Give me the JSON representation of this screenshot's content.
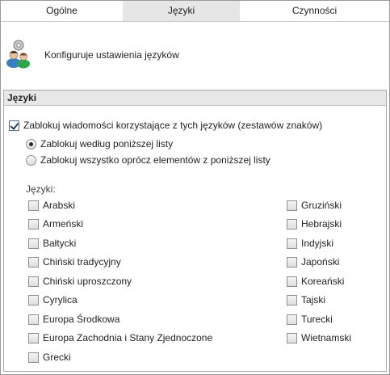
{
  "tabs": [
    {
      "label": "Ogólne"
    },
    {
      "label": "Języki"
    },
    {
      "label": "Czynności"
    }
  ],
  "header": {
    "icon": "users-settings-icon",
    "description": "Konfiguruje ustawienia języków"
  },
  "panel": {
    "title": "Języki",
    "block_checkbox": {
      "label": "Zablokuj wiadomości korzystające z tych języków (zestawów znaków)",
      "checked": true
    },
    "radio_options": [
      {
        "label": "Zablokuj według poniższej listy",
        "selected": true
      },
      {
        "label": "Zablokuj wszystko oprócz elementów z poniższej listy",
        "selected": false
      }
    ],
    "languages_label": "Języki:",
    "languages_left": [
      {
        "label": "Arabski",
        "checked": false
      },
      {
        "label": "Armeński",
        "checked": false
      },
      {
        "label": "Bałtycki",
        "checked": false
      },
      {
        "label": "Chiński tradycyjny",
        "checked": false
      },
      {
        "label": "Chiński uproszczony",
        "checked": false
      },
      {
        "label": "Cyrylica",
        "checked": false
      },
      {
        "label": "Europa Środkowa",
        "checked": false
      },
      {
        "label": "Europa Zachodnia i Stany Zjednoczone",
        "checked": false
      },
      {
        "label": "Grecki",
        "checked": false
      }
    ],
    "languages_right": [
      {
        "label": "Gruziński",
        "checked": false
      },
      {
        "label": "Hebrajski",
        "checked": false
      },
      {
        "label": "Indyjski",
        "checked": false
      },
      {
        "label": "Japoński",
        "checked": false
      },
      {
        "label": "Koreański",
        "checked": false
      },
      {
        "label": "Tajski",
        "checked": false
      },
      {
        "label": "Turecki",
        "checked": false
      },
      {
        "label": "Wietnamski",
        "checked": false
      }
    ]
  }
}
